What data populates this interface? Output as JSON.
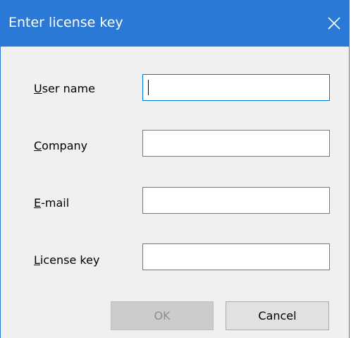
{
  "window": {
    "title": "Enter license key",
    "close_icon": "close-icon"
  },
  "form": {
    "user_name": {
      "label_mnemonic": "U",
      "label_rest": "ser name",
      "value": ""
    },
    "company": {
      "label_mnemonic": "C",
      "label_rest": "ompany",
      "value": ""
    },
    "email": {
      "label_mnemonic": "E",
      "label_rest": "-mail",
      "value": ""
    },
    "license_key": {
      "label_mnemonic": "L",
      "label_rest": "icense key",
      "value": ""
    }
  },
  "buttons": {
    "ok_label": "OK",
    "ok_enabled": false,
    "cancel_label": "Cancel"
  },
  "colors": {
    "titlebar": "#2b79d6",
    "focus_border": "#0078d7",
    "background": "#f0f0f0"
  }
}
